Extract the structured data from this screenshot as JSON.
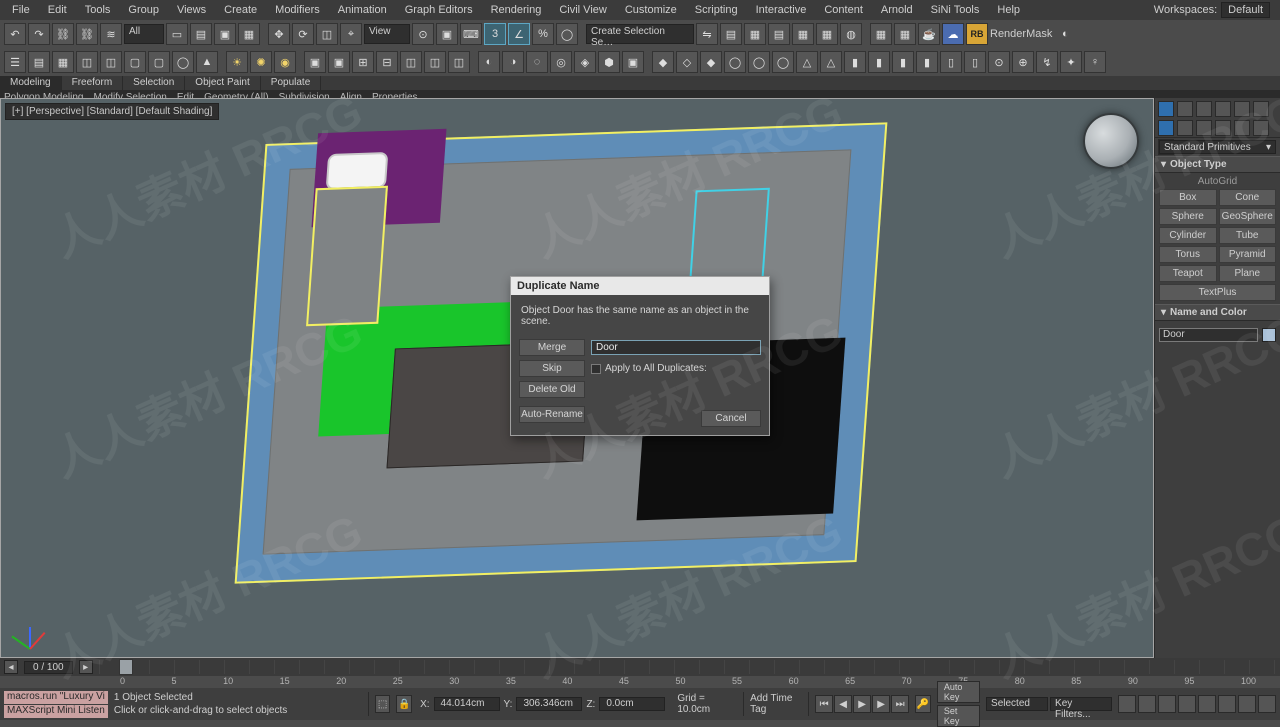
{
  "app": {
    "workspaces_label": "Workspaces:",
    "workspaces_value": "Default"
  },
  "menu": [
    "File",
    "Edit",
    "Tools",
    "Group",
    "Views",
    "Create",
    "Modifiers",
    "Animation",
    "Graph Editors",
    "Rendering",
    "Civil View",
    "Customize",
    "Scripting",
    "Interactive",
    "Content",
    "Arnold",
    "SiNi Tools",
    "Help"
  ],
  "toolbar": {
    "dropdown_all": "All",
    "dropdown_view": "View",
    "sel_set_placeholder": "Create Selection Se…",
    "rab_label": "RB",
    "rendermask_label": "RenderMask"
  },
  "ribbon": {
    "tabs": [
      "Modeling",
      "Freeform",
      "Selection",
      "Object Paint",
      "Populate"
    ],
    "active": 0,
    "sub": [
      "Polygon Modeling",
      "Modify Selection",
      "Edit",
      "Geometry (All)",
      "Subdivision",
      "Align",
      "Properties"
    ]
  },
  "viewport": {
    "label": "[+] [Perspective] [Standard] [Default Shading]"
  },
  "right_panel": {
    "category": "Standard Primitives",
    "rollout_objtype": "Object Type",
    "autogrid": "AutoGrid",
    "primitives": [
      "Box",
      "Cone",
      "Sphere",
      "GeoSphere",
      "Cylinder",
      "Tube",
      "Torus",
      "Pyramid",
      "Teapot",
      "Plane",
      "TextPlus"
    ],
    "rollout_namecolor": "Name and Color",
    "object_name": "Door"
  },
  "dialog": {
    "title": "Duplicate Name",
    "message": "Object Door has the same name as an object in the scene.",
    "btn_merge": "Merge",
    "btn_skip": "Skip",
    "btn_delete_old": "Delete Old",
    "btn_auto_rename": "Auto-Rename",
    "name_value": "Door",
    "apply_all_label": "Apply to All Duplicates:",
    "btn_cancel": "Cancel"
  },
  "timeline": {
    "frame_display": "0 / 100",
    "ticks": [
      "0",
      "5",
      "10",
      "15",
      "20",
      "25",
      "30",
      "35",
      "40",
      "45",
      "50",
      "55",
      "60",
      "65",
      "70",
      "75",
      "80",
      "85",
      "90",
      "95",
      "100"
    ]
  },
  "status": {
    "mxs_line1": "macros.run \"Luxury Vi",
    "mxs_line2": "MAXScript Mini Listen",
    "selection": "1 Object Selected",
    "prompt": "Click or click-and-drag to select objects",
    "x_label": "X:",
    "x_value": "44.014cm",
    "y_label": "Y:",
    "y_value": "306.346cm",
    "z_label": "Z:",
    "z_value": "0.0cm",
    "grid": "Grid = 10.0cm",
    "add_time_tag": "Add Time Tag",
    "auto_key": "Auto Key",
    "set_key": "Set Key",
    "selected_dd": "Selected",
    "key_filters": "Key Filters..."
  },
  "watermark": "人人素材 RRCG"
}
